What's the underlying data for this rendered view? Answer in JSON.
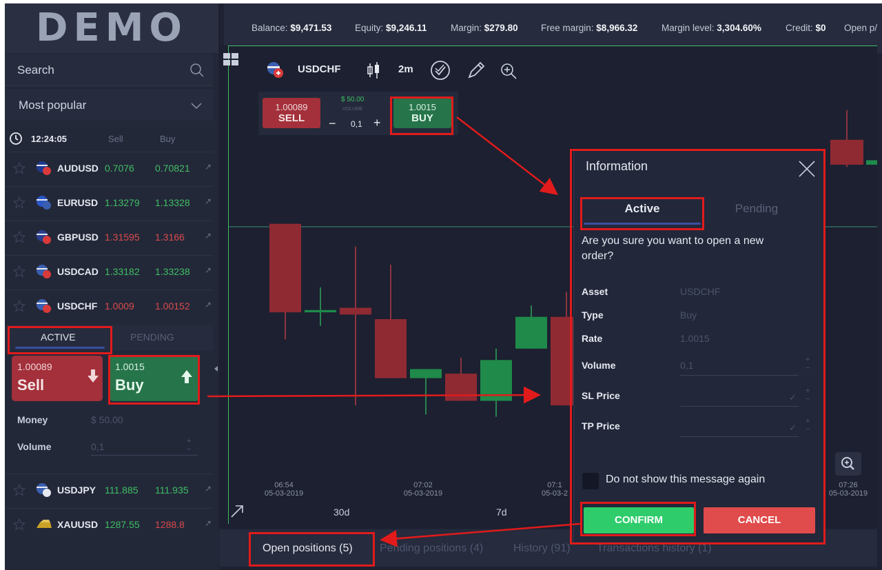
{
  "logo": "DEMO",
  "account": {
    "balance_label": "Balance:",
    "balance": "$9,471.53",
    "equity_label": "Equity:",
    "equity": "$9,246.11",
    "margin_label": "Margin:",
    "margin": "$279.80",
    "free_margin_label": "Free margin:",
    "free_margin": "$8,966.32",
    "margin_level_label": "Margin level:",
    "margin_level": "3,304.60%",
    "credit_label": "Credit:",
    "credit": "$0",
    "open_pl_label": "Open p/"
  },
  "sidebar": {
    "search_placeholder": "Search",
    "category": "Most popular",
    "clock": "12:24:05",
    "sell_header": "Sell",
    "buy_header": "Buy",
    "assets": [
      {
        "symbol": "AUDUSD",
        "sell": "0.7076",
        "buy": "0.70821",
        "sell_color": "green",
        "buy_color": "green"
      },
      {
        "symbol": "EURUSD",
        "sell": "1.13279",
        "buy": "1.13328",
        "sell_color": "green",
        "buy_color": "green"
      },
      {
        "symbol": "GBPUSD",
        "sell": "1.31595",
        "buy": "1.3166",
        "sell_color": "red",
        "buy_color": "red"
      },
      {
        "symbol": "USDCAD",
        "sell": "1.33182",
        "buy": "1.33238",
        "sell_color": "green",
        "buy_color": "green"
      },
      {
        "symbol": "USDCHF",
        "sell": "1.0009",
        "buy": "1.00152",
        "sell_color": "red",
        "buy_color": "red"
      }
    ],
    "tabs": {
      "active": "ACTIVE",
      "pending": "PENDING"
    },
    "trade": {
      "sell_price": "1.00089",
      "sell_label": "Sell",
      "buy_price": "1.0015",
      "buy_label": "Buy",
      "money_label": "Money",
      "money_value": "$ 50.00",
      "volume_label": "Volume",
      "volume_value": "0,1"
    },
    "assets_below": [
      {
        "symbol": "USDJPY",
        "sell": "111.885",
        "buy": "111.935",
        "sell_color": "green",
        "buy_color": "green"
      },
      {
        "symbol": "XAUUSD",
        "sell": "1287.55",
        "buy": "1288.8",
        "sell_color": "green",
        "buy_color": "red"
      }
    ]
  },
  "chart": {
    "symbol": "USDCHF",
    "period": "2m",
    "widget": {
      "sell_price": "1.00089",
      "sell_label": "SELL",
      "money": "$ 50.00",
      "volume_label": "VOLUME",
      "volume": "0,1",
      "buy_price": "1.0015",
      "buy_label": "BUY",
      "minus": "−",
      "plus": "+"
    },
    "time_labels": [
      {
        "time": "06:54",
        "date": "05-03-2019"
      },
      {
        "time": "07:02",
        "date": "05-03-2019"
      },
      {
        "time": "07:1",
        "date": "05-03-2"
      },
      {
        "time": "07:26",
        "date": "05-03-2019"
      }
    ],
    "ranges": [
      "30d",
      "7d"
    ]
  },
  "bottom_tabs": {
    "open": "Open positions (5)",
    "pending": "Pending positions (4)",
    "history": "History (91)",
    "transactions": "Transactions history (1)"
  },
  "modal": {
    "title": "Information",
    "tab_active": "Active",
    "tab_pending": "Pending",
    "question": "Are you sure you want to open a new order?",
    "rows": {
      "asset_label": "Asset",
      "asset": "USDCHF",
      "type_label": "Type",
      "type": "Buy",
      "rate_label": "Rate",
      "rate": "1.0015",
      "volume_label": "Volume",
      "volume": "0,1",
      "sl_label": "SL Price",
      "tp_label": "TP Price"
    },
    "dont_show": "Do not show this message again",
    "confirm": "CONFIRM",
    "cancel": "CANCEL"
  },
  "colors": {
    "green": "#3fbf62",
    "red": "#d94b4b",
    "confirm": "#2ecc6b",
    "cancel": "#e04b4b",
    "highlight": "#e11b1b"
  },
  "chart_data": {
    "candles": [
      {
        "open": 1.0019,
        "close": 1.00112,
        "high": 1.0019,
        "low": 1.00088,
        "color": "red"
      },
      {
        "open": 1.00112,
        "close": 1.00114,
        "high": 1.00134,
        "low": 1.001,
        "color": "green"
      },
      {
        "open": 1.00116,
        "close": 1.0011,
        "high": 1.0017,
        "low": 1.0003,
        "color": "red"
      },
      {
        "open": 1.00106,
        "close": 1.00054,
        "high": 1.00154,
        "low": 1.00054,
        "color": "red"
      },
      {
        "open": 1.00054,
        "close": 1.00062,
        "high": 1.00062,
        "low": 1.00022,
        "color": "green"
      },
      {
        "open": 1.00058,
        "close": 1.00034,
        "high": 1.00072,
        "low": 1.00034,
        "color": "red"
      },
      {
        "open": 1.00034,
        "close": 1.0007,
        "high": 1.0008,
        "low": 1.0002,
        "color": "green"
      },
      {
        "open": 1.0008,
        "close": 1.00108,
        "high": 1.00118,
        "low": 1.0008,
        "color": "green"
      },
      {
        "open": 1.00108,
        "close": 1.0003,
        "high": 1.0013,
        "low": 1.0003,
        "color": "red"
      }
    ],
    "right_candles": [
      {
        "open": 1.00264,
        "close": 1.00242,
        "high": 1.0029,
        "low": 1.0024,
        "color": "red"
      },
      {
        "open": 1.00242,
        "close": 1.00246,
        "high": 1.00248,
        "low": 1.0024,
        "color": "green"
      }
    ],
    "price_min": 0.9997,
    "price_max": 1.0031
  }
}
